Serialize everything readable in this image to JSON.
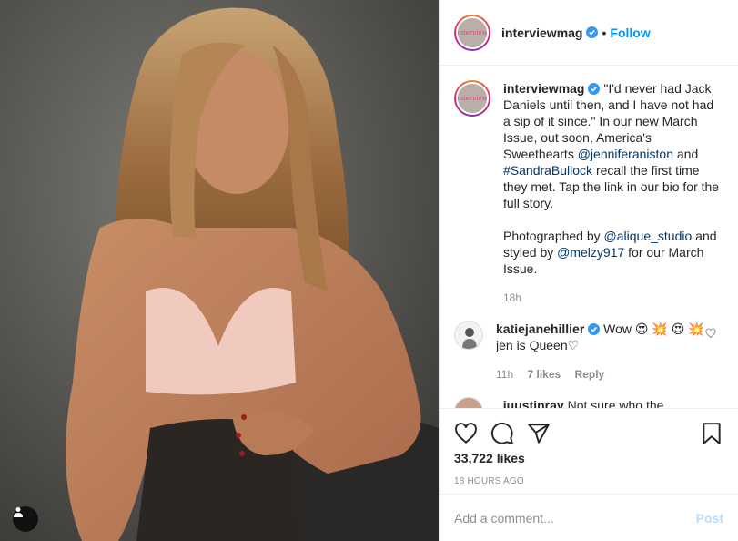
{
  "post": {
    "username": "interviewmag",
    "follow_label": "Follow",
    "separator": "•",
    "avatar_text": "interview"
  },
  "caption": {
    "username": "interviewmag",
    "text_1": "\"I'd never had Jack Daniels until then, and I have not had a sip of it since.\" In our new March Issue, out soon, America's Sweethearts ",
    "mention_1": "@jenniferaniston",
    "text_2": " and ",
    "hashtag_1": "#SandraBullock",
    "text_3": " recall the first time they met. Tap the link in our bio for the full story.",
    "text_4": "Photographed by ",
    "mention_2": "@alique_studio",
    "text_5": " and styled by ",
    "mention_3": "@melzy917",
    "text_6": " for our March Issue.",
    "age": "18h"
  },
  "comments": [
    {
      "username": "katiejanehillier",
      "text": "Wow 😍 💥 😍 💥 jen is Queen♡",
      "age": "11h",
      "likes": "7 likes",
      "reply_label": "Reply"
    },
    {
      "username": "_juustinray",
      "text": "Not sure who the"
    }
  ],
  "footer": {
    "likes": "33,722 likes",
    "timestamp": "18 HOURS AGO",
    "add_comment_placeholder": "Add a comment...",
    "post_label": "Post"
  },
  "colors": {
    "link": "#00376b",
    "accent": "#0095f6",
    "muted": "#8e8e8e",
    "post_disabled": "#b2dffc"
  }
}
